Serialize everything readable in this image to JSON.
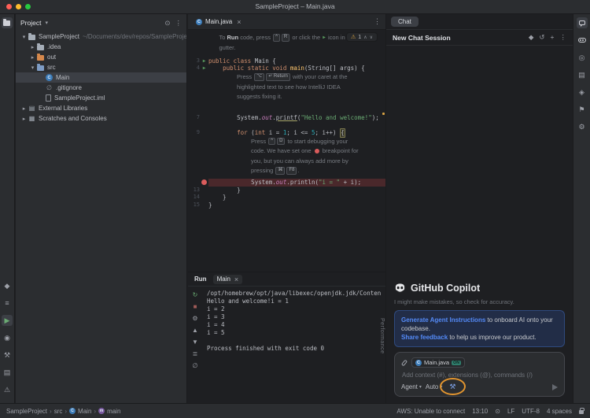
{
  "titlebar": {
    "title": "SampleProject – Main.java"
  },
  "stripes": {
    "left_top": [
      {
        "name": "project-tool-button",
        "type": "folder",
        "color": "#CED0D6",
        "active": true
      }
    ],
    "left_bottom": [
      {
        "name": "commit-tool-button",
        "glyph": "◆"
      },
      {
        "name": "structure-tool-button",
        "glyph": "≡"
      },
      {
        "name": "run-tool-button",
        "glyph": "▶",
        "color": "#6AAB73",
        "active": true
      },
      {
        "name": "debug-tool-button",
        "glyph": "◉"
      },
      {
        "name": "build-tool-button",
        "glyph": "⚒"
      },
      {
        "name": "terminal-tool-button",
        "glyph": "▤"
      },
      {
        "name": "problems-tool-button",
        "glyph": "⚠"
      }
    ],
    "right": [
      {
        "name": "chat-tool-button",
        "type": "bubble",
        "active": true
      },
      {
        "name": "copilot-tool-button",
        "type": "goggles"
      },
      {
        "name": "notifications-tool-button",
        "glyph": "◎"
      },
      {
        "name": "database-tool-button",
        "glyph": "▤"
      },
      {
        "name": "gradle-tool-button",
        "glyph": "◈"
      },
      {
        "name": "bookmarks-tool-button",
        "glyph": "⚑"
      },
      {
        "name": "settings-tool-button",
        "glyph": "⚙"
      }
    ]
  },
  "project": {
    "header": "Project",
    "header_icons": [
      {
        "name": "select-opened-file-icon",
        "glyph": "⊙"
      },
      {
        "name": "more-options-icon",
        "glyph": "⋮"
      }
    ],
    "items": [
      {
        "name": "tree-item-sampleproject",
        "label": "SampleProject",
        "detail": "~/Documents/dev/repos/SampleProje",
        "indent": 0,
        "chevron": "▾",
        "icon": "folder",
        "color": "#A6AEB8"
      },
      {
        "name": "tree-item-idea",
        "label": ".idea",
        "indent": 1,
        "chevron": "▸",
        "icon": "folder",
        "color": "#A6AEB8"
      },
      {
        "name": "tree-item-out",
        "label": "out",
        "indent": 1,
        "chevron": "▸",
        "icon": "folder",
        "color": "#D5884C"
      },
      {
        "name": "tree-item-src",
        "label": "src",
        "indent": 1,
        "chevron": "▾",
        "icon": "folder",
        "color": "#7E9CC4"
      },
      {
        "name": "tree-item-main",
        "label": "Main",
        "indent": 2,
        "icon": "class",
        "color": "#3D7DBA",
        "selected": true
      },
      {
        "name": "tree-item-gitignore",
        "label": ".gitignore",
        "indent": 2,
        "icon": "slash"
      },
      {
        "name": "tree-item-sampleproject-iml",
        "label": "SampleProject.iml",
        "indent": 2,
        "icon": "file"
      },
      {
        "name": "tree-item-external-libraries",
        "label": "External Libraries",
        "indent": 0,
        "chevron": "▸",
        "icon": "lib"
      },
      {
        "name": "tree-item-scratches",
        "label": "Scratches and Consoles",
        "indent": 0,
        "chevron": "▸",
        "icon": "scratch"
      }
    ]
  },
  "editor": {
    "tab_label": "Main.java",
    "warning_count": "1",
    "lines": [
      {
        "t": "hint",
        "ind": 3,
        "seg": [
          [
            "To ",
            "hint"
          ],
          [
            "Run",
            "hintb"
          ],
          [
            " code, press ",
            "hint"
          ],
          [
            "^",
            "kbd"
          ],
          [
            "R",
            "kbd"
          ],
          [
            " or click the ",
            "hint"
          ],
          [
            "▶",
            "play"
          ],
          [
            " icon in the",
            "hint"
          ]
        ]
      },
      {
        "t": "hint",
        "ind": 3,
        "gap": 6,
        "seg": [
          [
            "gutter.",
            "hint"
          ]
        ]
      },
      {
        "t": "code",
        "num": "3",
        "g": "play",
        "seg": [
          [
            "public class ",
            "kw"
          ],
          [
            "Main {",
            "pl"
          ]
        ]
      },
      {
        "t": "code",
        "num": "4",
        "g": "play",
        "seg": [
          [
            "    ",
            "pl"
          ],
          [
            "public static void ",
            "kw"
          ],
          [
            "main",
            "mth"
          ],
          [
            "(String[] args) {",
            "pl"
          ]
        ]
      },
      {
        "t": "hint",
        "ind": 8,
        "seg": [
          [
            "Press ",
            "hint"
          ],
          [
            "⌥",
            "kbd"
          ],
          [
            "↵ Return",
            "kbd"
          ],
          [
            " with your caret at the",
            "hint"
          ]
        ]
      },
      {
        "t": "hint",
        "ind": 8,
        "seg": [
          [
            "highlighted text to see how IntelliJ IDEA",
            "hint"
          ]
        ]
      },
      {
        "t": "hint",
        "ind": 8,
        "gap": 6,
        "seg": [
          [
            "suggests fixing it.",
            "hint"
          ]
        ]
      },
      {
        "t": "code",
        "seg": []
      },
      {
        "t": "code",
        "num": "7",
        "seg": [
          [
            "        System.",
            "pl"
          ],
          [
            "out",
            "fld"
          ],
          [
            ".",
            "pl"
          ],
          [
            "printf",
            "ul"
          ],
          [
            "(",
            "pl"
          ],
          [
            "\"Hello and welcome!\"",
            "str"
          ],
          [
            ");",
            "pl"
          ]
        ]
      },
      {
        "t": "code",
        "seg": []
      },
      {
        "t": "code",
        "num": "9",
        "seg": [
          [
            "        ",
            "pl"
          ],
          [
            "for",
            "kw"
          ],
          [
            " (",
            "pl"
          ],
          [
            "int",
            "kw"
          ],
          [
            " i = ",
            "pl"
          ],
          [
            "1",
            "num"
          ],
          [
            "; i <= ",
            "pl"
          ],
          [
            "5",
            "num"
          ],
          [
            "; i++) ",
            "pl"
          ],
          [
            "{",
            "box"
          ]
        ]
      },
      {
        "t": "hint",
        "ind": 12,
        "seg": [
          [
            "Press ",
            "hint"
          ],
          [
            "^",
            "kbd"
          ],
          [
            "D",
            "kbd"
          ],
          [
            " to start debugging your",
            "hint"
          ]
        ]
      },
      {
        "t": "hint",
        "ind": 12,
        "seg": [
          [
            "code. We have set one ",
            "hint"
          ],
          [
            "",
            "dot"
          ],
          [
            " breakpoint for",
            "hint"
          ]
        ]
      },
      {
        "t": "hint",
        "ind": 12,
        "seg": [
          [
            "you, but you can always add more by",
            "hint"
          ]
        ]
      },
      {
        "t": "hint",
        "ind": 12,
        "gap": 4,
        "seg": [
          [
            "pressing ",
            "hint"
          ],
          [
            "⌘",
            "kbd"
          ],
          [
            "F8",
            "kbd"
          ],
          [
            ".",
            "hint"
          ]
        ]
      },
      {
        "t": "code",
        "bp": true,
        "g": "dot",
        "seg": [
          [
            "            System.",
            "pl"
          ],
          [
            "out",
            "fld"
          ],
          [
            ".println(",
            "pl"
          ],
          [
            "\"i = \"",
            "str"
          ],
          [
            " + i);",
            "pl"
          ]
        ]
      },
      {
        "t": "code",
        "num": "13",
        "seg": [
          [
            "        }",
            "pl"
          ]
        ]
      },
      {
        "t": "code",
        "num": "14",
        "seg": [
          [
            "    }",
            "pl"
          ]
        ]
      },
      {
        "t": "code",
        "num": "15",
        "seg": [
          [
            "}",
            "pl"
          ]
        ]
      }
    ]
  },
  "run": {
    "title": "Run",
    "tab": "Main",
    "perf_label": "Performance",
    "toolbar": [
      {
        "name": "rerun-icon",
        "glyph": "↻",
        "color": "#6AAB73"
      },
      {
        "name": "stop-icon",
        "glyph": "■",
        "color": "#9E5A57"
      },
      {
        "name": "settings-icon",
        "glyph": "⚙"
      },
      {
        "name": "up-stack-icon",
        "glyph": "▲"
      },
      {
        "name": "down-stack-icon",
        "glyph": "▼"
      },
      {
        "name": "soft-wrap-icon",
        "glyph": "≣"
      },
      {
        "name": "clear-console-icon",
        "glyph": "∅"
      }
    ],
    "console": [
      "/opt/homebrew/opt/java/libexec/openjdk.jdk/Conten",
      "Hello and welcome!i = 1",
      "i = 2",
      "i = 3",
      "i = 4",
      "i = 5",
      "",
      "Process finished with exit code 0"
    ]
  },
  "chat": {
    "tab": "Chat",
    "session_title": "New Chat Session",
    "header_icons": [
      {
        "name": "model-picker-icon",
        "glyph": "◆"
      },
      {
        "name": "history-icon",
        "glyph": "↺"
      },
      {
        "name": "new-chat-icon",
        "glyph": "+"
      },
      {
        "name": "more-options-icon",
        "glyph": "⋮"
      }
    ],
    "brand": "GitHub Copilot",
    "disclaimer": "I might make mistakes, so check for accuracy.",
    "notice_link1": "Generate Agent Instructions",
    "notice_text1": " to onboard AI onto your codebase.",
    "notice_link2": "Share feedback",
    "notice_text2": " to help us improve our product.",
    "context_chip": "Main.java",
    "context_badge": "ON",
    "placeholder": "Add context (#), extensions (@), commands (/)",
    "agent_selector": "Agent",
    "model_selector": "Auto",
    "accent": "#548AF7"
  },
  "statusbar": {
    "breadcrumbs": [
      {
        "label": "SampleProject"
      },
      {
        "label": "src"
      },
      {
        "label": "Main",
        "icon": "class"
      },
      {
        "label": "main",
        "icon": "method"
      }
    ],
    "right": [
      {
        "name": "aws-status",
        "label": "AWS: Unable to connect"
      },
      {
        "name": "clock",
        "label": "13:10"
      },
      {
        "name": "status-indicator-icon",
        "glyph": "⊙"
      },
      {
        "name": "line-separator",
        "label": "LF"
      },
      {
        "name": "file-encoding",
        "label": "UTF-8"
      },
      {
        "name": "indent-config",
        "label": "4 spaces"
      },
      {
        "name": "lock-icon",
        "icon": "lock"
      }
    ]
  }
}
